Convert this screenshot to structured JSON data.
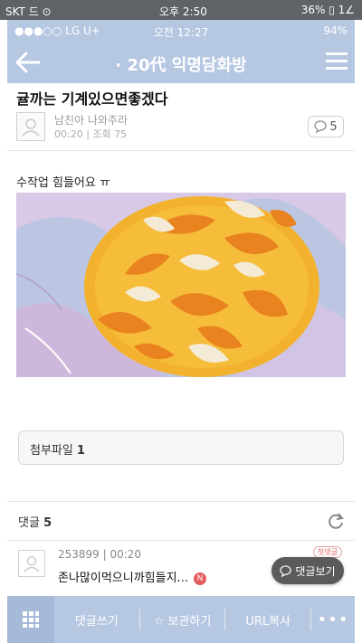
{
  "outer_status": {
    "left": "SKT 드 ⊙",
    "center": "오후 2:50",
    "right": "36% ▯ 1∠"
  },
  "inner_status": {
    "left": "●●●○○ LG U+",
    "center": "오전 12:27",
    "right": "94%"
  },
  "header": {
    "title": "· 20代 익명담화방"
  },
  "post": {
    "title": "귤까는 기계있으면좋겠다",
    "author": "남친아 나와주라",
    "time": "00:20",
    "views": "조회 75",
    "comment_count": "5",
    "body": "수작업 힘들어요 ㅠ"
  },
  "attachment": {
    "label": "첨부파일",
    "count": "1"
  },
  "comments": {
    "label": "댓글",
    "count": "5",
    "items": [
      {
        "id": "253899",
        "time": "00:20",
        "text": "존나많이먹으니까힘들지...",
        "new": "N",
        "badge": "첫댓글"
      }
    ]
  },
  "fab": {
    "label": "댓글보기"
  },
  "bottom_bar": {
    "write": "댓글쓰기",
    "save": "보관하기",
    "copy_url": "URL복사",
    "more": "•••"
  },
  "colors": {
    "accent": "#b6c7e2",
    "accent_dark": "#a6b9d8",
    "plate": "#f3b22d",
    "orange": "#e8831f"
  }
}
